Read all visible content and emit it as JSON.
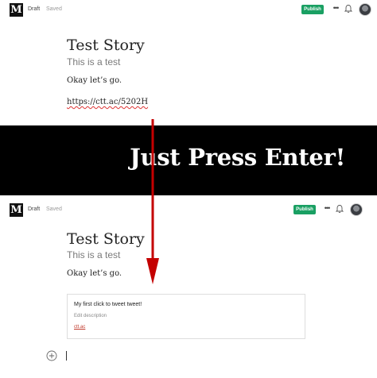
{
  "editor": {
    "logo": "M",
    "status_draft": "Draft",
    "status_saved": "Saved",
    "publish_label": "Publish",
    "more_icon": "more-horizontal-icon",
    "bell_icon": "bell-icon",
    "accent_color": "#1aa063"
  },
  "before": {
    "title": "Test Story",
    "subtitle": "This is a test",
    "paragraph": "Okay let’s go.",
    "link": "https://ctt.ac/5202H"
  },
  "banner": {
    "text": "Just Press Enter!"
  },
  "after": {
    "title": "Test Story",
    "subtitle": "This is a test",
    "paragraph": "Okay let’s go.",
    "embed": {
      "title": "My first click to tweet tweet!",
      "description": "Edit description",
      "domain": "ctt.ac"
    }
  },
  "annotation": {
    "arrow_color": "#c40000"
  }
}
